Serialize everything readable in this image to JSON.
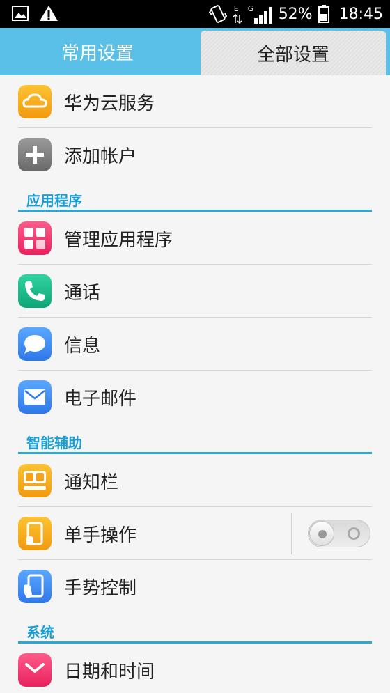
{
  "status_bar": {
    "network_type": "E",
    "network_gen": "G",
    "battery_percent": "52%",
    "time": "18:45"
  },
  "tabs": {
    "common": "常用设置",
    "all": "全部设置"
  },
  "rows": {
    "huawei_cloud": "华为云服务",
    "add_account": "添加帐户",
    "manage_apps": "管理应用程序",
    "calls": "通话",
    "messages": "信息",
    "email": "电子邮件",
    "notification_bar": "通知栏",
    "one_hand": "单手操作",
    "gesture_control": "手势控制",
    "date_time": "日期和时间"
  },
  "sections": {
    "apps": "应用程序",
    "smart_assist": "智能辅助",
    "system": "系统"
  },
  "toggles": {
    "one_hand_on": false
  }
}
